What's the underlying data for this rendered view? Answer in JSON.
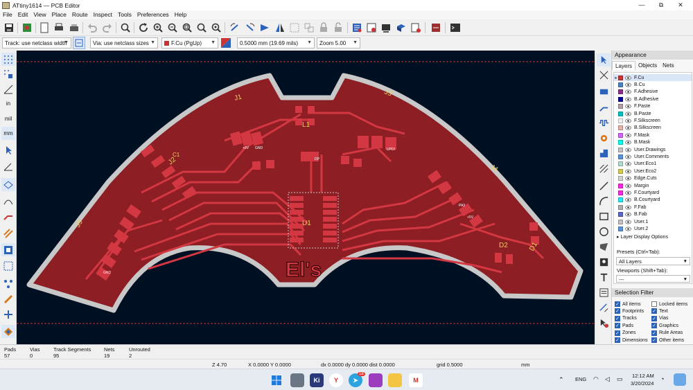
{
  "window": {
    "title": "ATtiny1614 — PCB Editor",
    "minimize": "—",
    "maximize": "⧉",
    "close": "✕"
  },
  "menu": [
    "File",
    "Edit",
    "View",
    "Place",
    "Route",
    "Inspect",
    "Tools",
    "Preferences",
    "Help"
  ],
  "optionbar": {
    "track": "Track: use netclass width",
    "via": "Via: use netclass sizes",
    "layer": "F.Cu (PgUp)",
    "grid": "0.5000 mm (19.69 mils)",
    "zoom": "Zoom 5.00"
  },
  "lefttools": [
    "grid-icon",
    "grid-overrides-icon",
    "polar-icon",
    "inch-icon",
    "mil-icon",
    "mm-icon",
    "cursor-icon",
    "angle-icon",
    "ratsnest-icon",
    "curved-ratsnest-icon",
    "tracks-icon",
    "fill-zones-icon",
    "unfilled-zones-icon",
    "pads-icon",
    "vias-icon",
    "net-color-icon",
    "highlight-icon",
    "layers-3d-icon"
  ],
  "lefttool_labels": {
    "inch": "in",
    "mil": "mil",
    "mm": "mm"
  },
  "pcb": {
    "logo_text": "El's",
    "refs": [
      "J1",
      "J2",
      "J3",
      "J4",
      "J5",
      "D1",
      "D2",
      "U1",
      "L1",
      "C1"
    ],
    "pad_labels": [
      "+5V",
      "GND",
      "DP",
      "PA3",
      "UPDI",
      "GND",
      "+5V"
    ],
    "colors": {
      "board": "#8d1e23",
      "track": "#d33742",
      "outline": "#c8c8c8",
      "background": "#001023",
      "silk": "#e8d060"
    }
  },
  "appearance": {
    "header": "Appearance",
    "tabs": [
      "Layers",
      "Objects",
      "Nets"
    ],
    "layers": [
      {
        "name": "F.Cu",
        "color": "#c83434"
      },
      {
        "name": "B.Cu",
        "color": "#4d7fc4"
      },
      {
        "name": "F.Adhesive",
        "color": "#8a2f8a"
      },
      {
        "name": "B.Adhesive",
        "color": "#06069d"
      },
      {
        "name": "F.Paste",
        "color": "#b4a0a0"
      },
      {
        "name": "B.Paste",
        "color": "#00c2c2"
      },
      {
        "name": "F.Silkscreen",
        "color": "#f0f0f0"
      },
      {
        "name": "B.Silkscreen",
        "color": "#e8b2a7"
      },
      {
        "name": "F.Mask",
        "color": "#d864ff"
      },
      {
        "name": "B.Mask",
        "color": "#02ffee"
      },
      {
        "name": "User.Drawings",
        "color": "#c2c2c2"
      },
      {
        "name": "User.Comments",
        "color": "#5994da"
      },
      {
        "name": "User.Eco1",
        "color": "#b4dbd2"
      },
      {
        "name": "User.Eco2",
        "color": "#d8c852"
      },
      {
        "name": "Edge.Cuts",
        "color": "#d0d2cd"
      },
      {
        "name": "Margin",
        "color": "#ff26e2"
      },
      {
        "name": "F.Courtyard",
        "color": "#ff26e2"
      },
      {
        "name": "B.Courtyard",
        "color": "#26e9ff"
      },
      {
        "name": "F.Fab",
        "color": "#afafaf"
      },
      {
        "name": "B.Fab",
        "color": "#5868cc"
      },
      {
        "name": "User.1",
        "color": "#c2c2c2"
      },
      {
        "name": "User.2",
        "color": "#5994da"
      }
    ],
    "layer_display_options": "Layer Display Options",
    "presets_label": "Presets (Ctrl+Tab):",
    "presets_value": "All Layers",
    "viewports_label": "Viewports (Shift+Tab):",
    "viewports_value": "---"
  },
  "selection_filter": {
    "header": "Selection Filter",
    "items": [
      {
        "label": "All items",
        "checked": true
      },
      {
        "label": "Locked items",
        "checked": false
      },
      {
        "label": "Footprints",
        "checked": true
      },
      {
        "label": "Text",
        "checked": true
      },
      {
        "label": "Tracks",
        "checked": true
      },
      {
        "label": "Vias",
        "checked": true
      },
      {
        "label": "Pads",
        "checked": true
      },
      {
        "label": "Graphics",
        "checked": true
      },
      {
        "label": "Zones",
        "checked": true
      },
      {
        "label": "Rule Areas",
        "checked": true
      },
      {
        "label": "Dimensions",
        "checked": true
      },
      {
        "label": "Other items",
        "checked": true
      }
    ]
  },
  "stats": [
    {
      "label": "Pads",
      "value": "57"
    },
    {
      "label": "Vias",
      "value": "0"
    },
    {
      "label": "Track Segments",
      "value": "95"
    },
    {
      "label": "Nets",
      "value": "19"
    },
    {
      "label": "Unrouted",
      "value": "2"
    }
  ],
  "statusbar": {
    "z": "Z 4.70",
    "xy": "X 0.0000  Y 0.0000",
    "delta": "dx 0.0000  dy 0.0000  dist 0.0000",
    "grid": "grid 0.5000",
    "units": "mm"
  },
  "taskbar": {
    "lang": "ENG",
    "time": "12:12 AM",
    "date": "3/20/2024",
    "telegram_badge": "18"
  }
}
